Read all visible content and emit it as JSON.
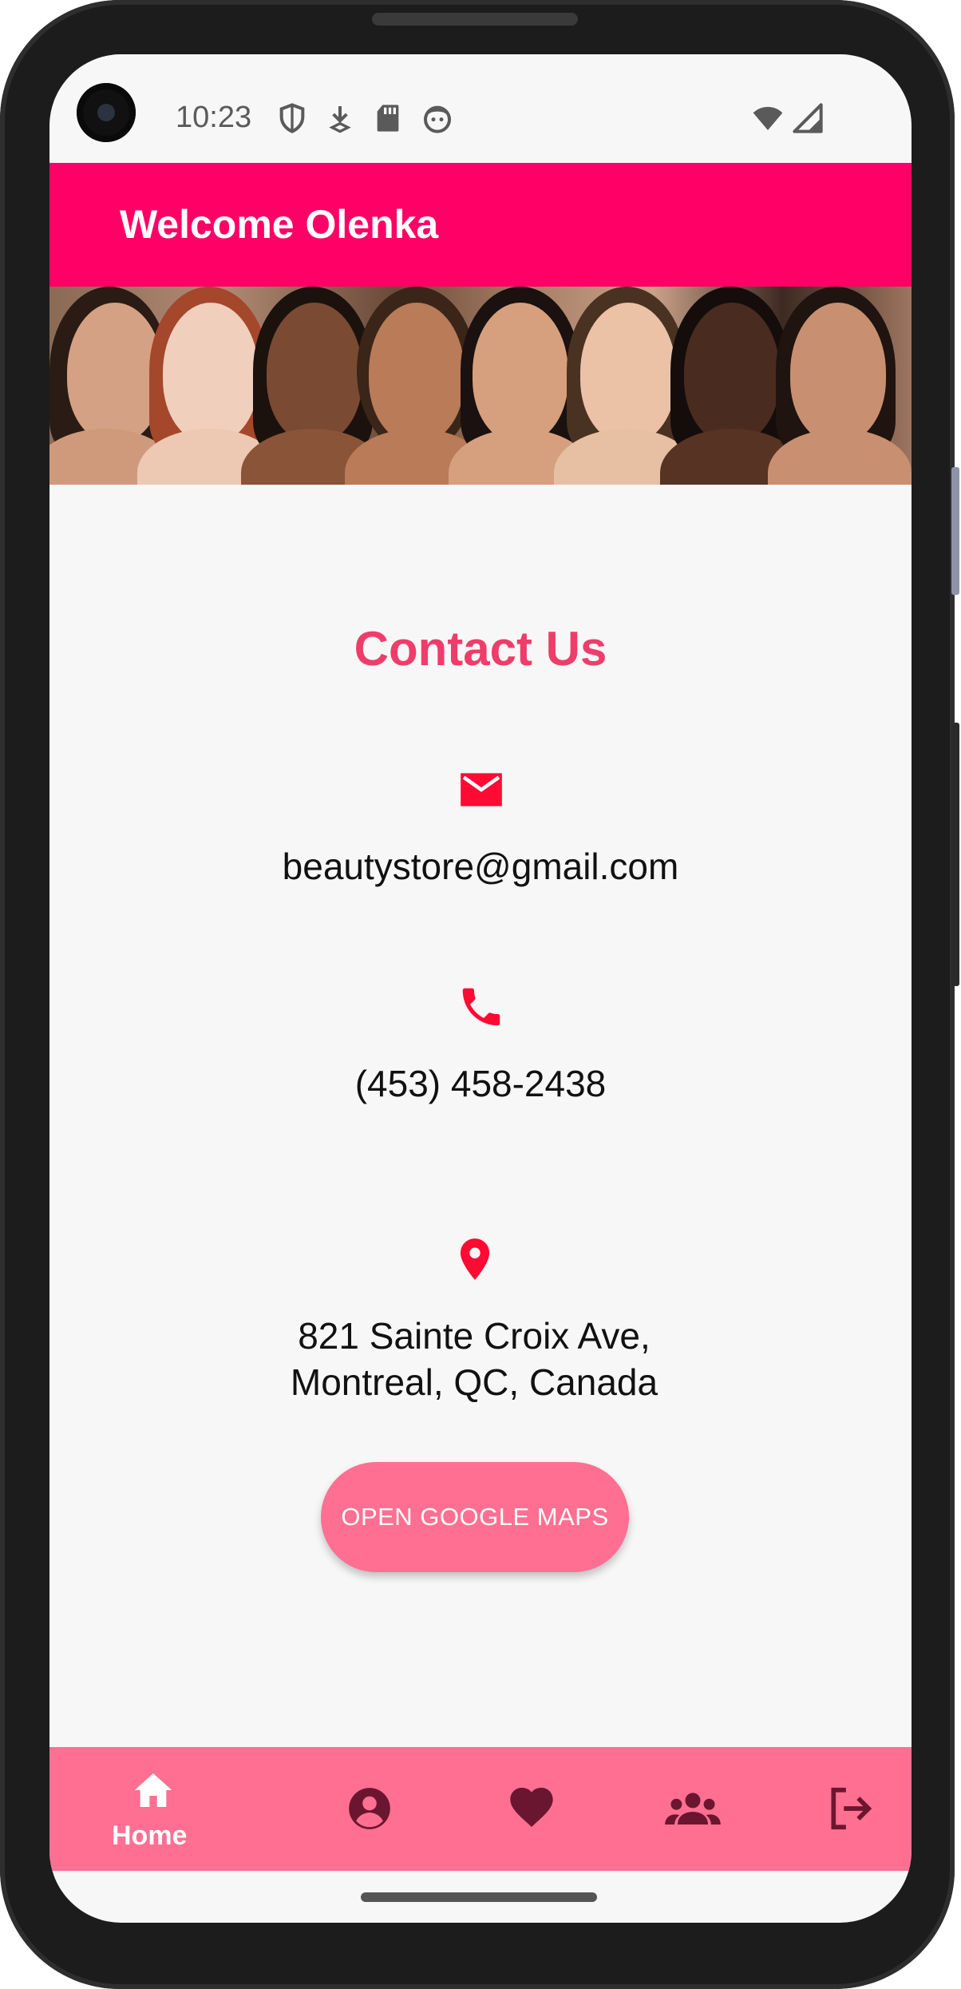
{
  "status_bar": {
    "time": "10:23",
    "icons": [
      "shield-icon",
      "download-icon",
      "sd-card-icon",
      "android-robot-icon",
      "wifi-icon",
      "cellular-signal-icon"
    ]
  },
  "app_bar": {
    "title": "Welcome Olenka",
    "color": "#ff0066"
  },
  "banner": {
    "icon": "models-banner-image"
  },
  "contact": {
    "title": "Contact Us",
    "email_icon": "email-icon",
    "email": "beautystore@gmail.com",
    "phone_icon": "phone-icon",
    "phone": "(453) 458-2438",
    "location_icon": "location-pin-icon",
    "address_line1": "821 Sainte Croix Ave,",
    "address_line2": "Montreal, QC, Canada",
    "maps_button": "OPEN GOOGLE MAPS",
    "accent_color": "#ee3d6a",
    "icon_color": "#ff0a33"
  },
  "bottom_nav": {
    "color": "#ff6f91",
    "items": [
      {
        "icon": "home-icon",
        "label": "Home",
        "active": true
      },
      {
        "icon": "account-icon",
        "label": "",
        "active": false
      },
      {
        "icon": "heart-icon",
        "label": "",
        "active": false
      },
      {
        "icon": "group-icon",
        "label": "",
        "active": false
      },
      {
        "icon": "logout-icon",
        "label": "",
        "active": false
      }
    ]
  }
}
